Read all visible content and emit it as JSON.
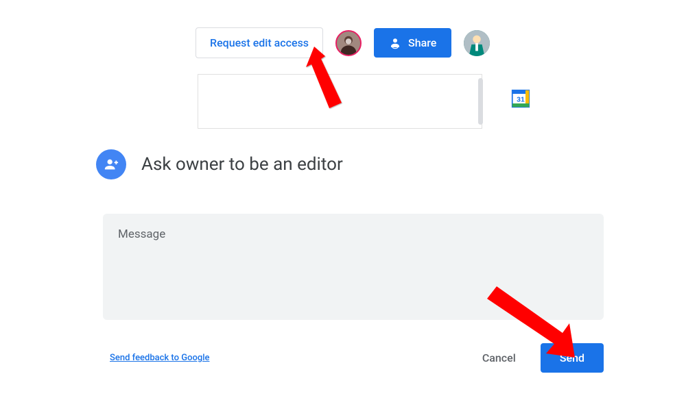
{
  "toolbar": {
    "request_label": "Request edit access",
    "share_label": "Share"
  },
  "sidebar": {
    "calendar_day": "31"
  },
  "dialog": {
    "title": "Ask owner to be an editor",
    "message_placeholder": "Message",
    "feedback_link": "Send feedback to Google",
    "cancel_label": "Cancel",
    "send_label": "Send"
  }
}
